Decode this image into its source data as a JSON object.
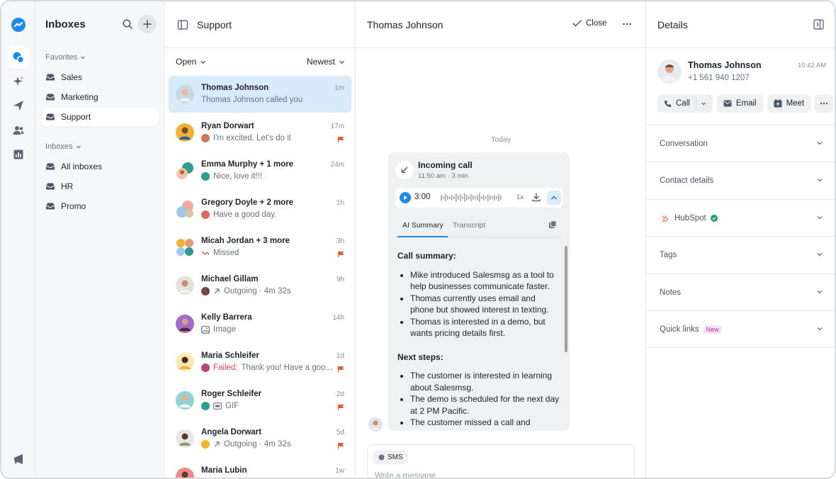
{
  "rail": {
    "icons": [
      "logo-icon",
      "chat-icon",
      "sparkle-icon",
      "send-icon",
      "contacts-icon",
      "reports-icon",
      "megaphone-icon"
    ]
  },
  "inboxes": {
    "title": "Inboxes",
    "favorites_label": "Favorites",
    "favorites": [
      {
        "label": "Sales"
      },
      {
        "label": "Marketing"
      },
      {
        "label": "Support"
      }
    ],
    "inboxes_label": "Inboxes",
    "inboxes": [
      {
        "label": "All inboxes"
      },
      {
        "label": "HR"
      },
      {
        "label": "Promo"
      }
    ]
  },
  "list": {
    "title": "Support",
    "filter_status": "Open",
    "filter_sort": "Newest",
    "conversations": [
      {
        "name": "Thomas Johnson",
        "preview": "Thomas Johnson called you",
        "time": "1m",
        "flag": false,
        "color": "#c9d7e3"
      },
      {
        "name": "Ryan Dorwart",
        "preview": "I'm excited. Let's do it",
        "time": "17m",
        "flag": true,
        "color": "#f2b233"
      },
      {
        "name": "Emma Murphy + 1 more",
        "preview": "Nice, love it!!!",
        "time": "24m",
        "flag": false,
        "color": "#2f9c8f"
      },
      {
        "name": "Gregory Doyle + 2 more",
        "preview": "Have a good day.",
        "time": "1h",
        "flag": false,
        "color": "#9ec9e8"
      },
      {
        "name": "Micah Jordan + 3 more",
        "preview": "Missed",
        "time": "3h",
        "flag": true,
        "color": "#e89a6b"
      },
      {
        "name": "Michael Gillam",
        "preview": "Outgoing · 4m 32s",
        "time": "9h",
        "flag": false,
        "color": "#d9d2c7"
      },
      {
        "name": "Kelly Barrera",
        "preview": "Image",
        "time": "14h",
        "flag": false,
        "color": "#a46ad0"
      },
      {
        "name": "Maria Schleifer",
        "failed": "Failed:",
        "preview": "Thank you! Have a goo...",
        "time": "1d",
        "flag": true,
        "color": "#f2c94c"
      },
      {
        "name": "Roger Schleifer",
        "preview": "GIF",
        "time": "2d",
        "flag": true,
        "color": "#8fd3d1"
      },
      {
        "name": "Angela Dorwart",
        "preview": "Outgoing · 4m 32s",
        "time": "5d",
        "flag": true,
        "color": "#e5e7ea"
      },
      {
        "name": "Maria Lubin",
        "preview": "",
        "time": "1w",
        "flag": false,
        "color": "#f08b8b"
      }
    ]
  },
  "thread": {
    "title": "Thomas Johnson",
    "close_label": "Close",
    "day_divider": "Today",
    "call": {
      "title": "Incoming call",
      "subtitle": "11:50 am · 3 min",
      "duration": "3:00",
      "speed": "1x",
      "tab_summary": "AI Summary",
      "tab_transcript": "Transcript",
      "summary_heading": "Call summary:",
      "summary_items": [
        "Mike introduced Salesmsg as a tool to help businesses communicate faster.",
        "Thomas currently uses email and phone but showed interest in texting.",
        "Thomas is interested in a demo, but wants pricing details first."
      ],
      "next_heading": "Next steps:",
      "next_items": [
        "The customer is interested in learning about Salesmsg.",
        "The demo is scheduled for the next day at 2 PM Pacific.",
        "The customer missed a call and"
      ]
    },
    "composer": {
      "channel": "SMS",
      "placeholder": "Write a message"
    }
  },
  "details": {
    "title": "Details",
    "contact": {
      "name": "Thomas Johnson",
      "phone": "+1 561 940 1207",
      "time": "10:42 AM"
    },
    "actions": {
      "call": "Call",
      "email": "Email",
      "meet": "Meet"
    },
    "sections": [
      {
        "label": "Conversation"
      },
      {
        "label": "Contact details"
      },
      {
        "label": "HubSpot"
      },
      {
        "label": "Tags"
      },
      {
        "label": "Notes"
      },
      {
        "label": "Quick links",
        "badge": "New"
      }
    ]
  },
  "colors": {
    "accent": "#1f8ae9",
    "selected_row": "#d8ebf8",
    "flag": "#f05a28",
    "failed": "#e5484d",
    "hubspot": "#ff7a59",
    "verified": "#22a06b"
  }
}
